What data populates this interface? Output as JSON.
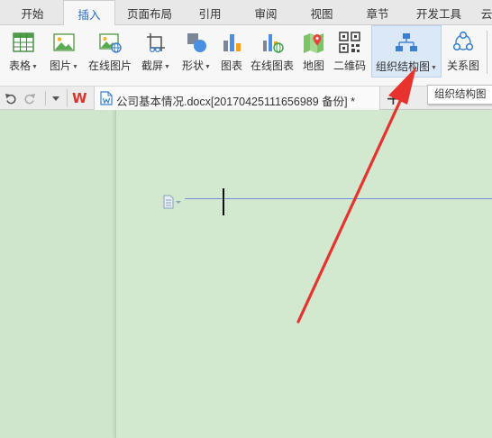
{
  "menu": {
    "tabs": [
      {
        "label": "开始"
      },
      {
        "label": "插入",
        "active": true
      },
      {
        "label": "页面布局"
      },
      {
        "label": "引用"
      },
      {
        "label": "审阅"
      },
      {
        "label": "视图"
      },
      {
        "label": "章节"
      },
      {
        "label": "开发工具"
      },
      {
        "label": "云"
      }
    ]
  },
  "ribbon": {
    "items": [
      {
        "label": "表格",
        "has_dropdown": true,
        "icon": "table-icon"
      },
      {
        "label": "图片",
        "has_dropdown": true,
        "icon": "picture-icon"
      },
      {
        "label": "在线图片",
        "has_dropdown": false,
        "icon": "online-picture-icon"
      },
      {
        "label": "截屏",
        "has_dropdown": true,
        "icon": "screenshot-icon"
      },
      {
        "label": "形状",
        "has_dropdown": true,
        "icon": "shapes-icon"
      },
      {
        "label": "图表",
        "has_dropdown": false,
        "icon": "chart-icon"
      },
      {
        "label": "在线图表",
        "has_dropdown": false,
        "icon": "online-chart-icon"
      },
      {
        "label": "地图",
        "has_dropdown": false,
        "icon": "map-icon"
      },
      {
        "label": "二维码",
        "has_dropdown": false,
        "icon": "qrcode-icon"
      },
      {
        "label": "组织结构图",
        "has_dropdown": true,
        "icon": "org-chart-icon",
        "highlighted": true
      },
      {
        "label": "关系图",
        "has_dropdown": false,
        "icon": "relationship-icon"
      }
    ]
  },
  "doc_tabs": {
    "logo_glyph": "W",
    "current": {
      "title": "公司基本情况.docx[20170425111656989 备份]",
      "modified_mark": "*"
    },
    "new_tab_symbol": "+"
  },
  "tooltip": {
    "text": "组织结构图"
  },
  "colors": {
    "accent": "#2a6fc9",
    "wps_red": "#d9322d",
    "page_bg": "#d2e8cf",
    "annotation_arrow": "#e8322e",
    "paragraph_line": "#6e8fd8"
  }
}
